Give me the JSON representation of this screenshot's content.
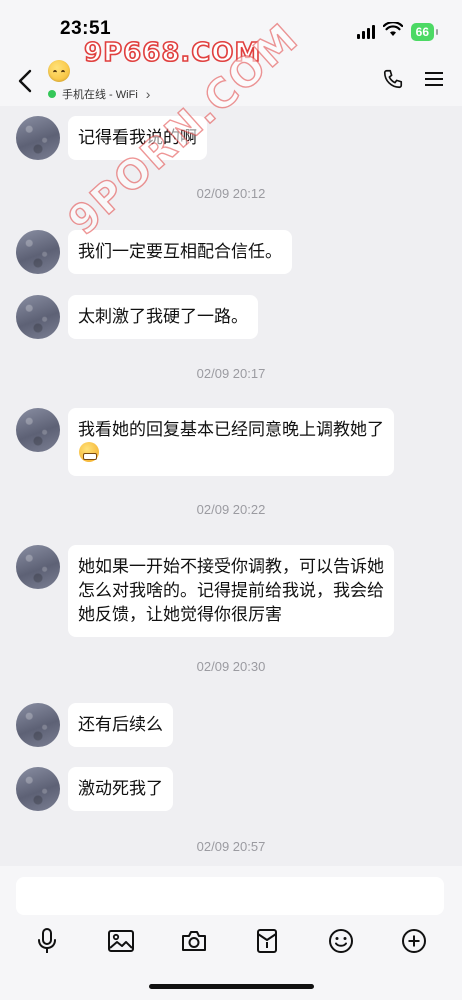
{
  "status_bar": {
    "time": "23:51",
    "battery": "66"
  },
  "header": {
    "presence": "手机在线 - WiFi",
    "presence_chevron": "›"
  },
  "watermarks": {
    "top": "9P668.COM",
    "diagonal": "9PORN.COM"
  },
  "messages": [
    {
      "type": "text",
      "text": "记得看我说的啊"
    },
    {
      "type": "time",
      "text": "02/09 20:12"
    },
    {
      "type": "text",
      "text": "我们一定要互相配合信任。"
    },
    {
      "type": "text",
      "text": "太刺激了我硬了一路。"
    },
    {
      "type": "time",
      "text": "02/09 20:17"
    },
    {
      "type": "text",
      "text": "我看她的回复基本已经同意晚上调教她了"
    },
    {
      "type": "time",
      "text": "02/09 20:22"
    },
    {
      "type": "text",
      "text": "她如果一开始不接受你调教，可以告诉她怎么对我啥的。记得提前给我说，我会给她反馈，让她觉得你很厉害"
    },
    {
      "type": "time",
      "text": "02/09 20:30"
    },
    {
      "type": "text",
      "text": "还有后续么"
    },
    {
      "type": "text",
      "text": "激动死我了"
    },
    {
      "type": "time",
      "text": "02/09 20:57"
    }
  ],
  "input": {
    "placeholder": ""
  },
  "toolbar": {
    "icons": [
      "microphone-icon",
      "image-icon",
      "camera-icon",
      "red-packet-icon",
      "emoji-icon",
      "plus-icon"
    ]
  },
  "colors": {
    "online": "#35c759",
    "battery": "#4cd964",
    "watermark": "#e0403f",
    "background": "#efeff2"
  }
}
